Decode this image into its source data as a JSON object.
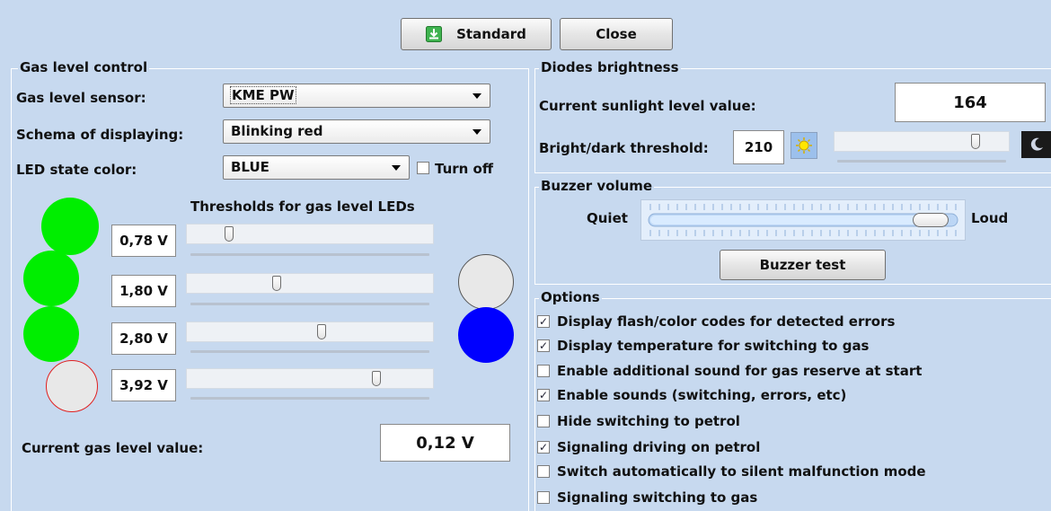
{
  "toolbar": {
    "standard_label": "Standard",
    "close_label": "Close"
  },
  "gas_level_control": {
    "legend": "Gas level control",
    "sensor_label": "Gas level sensor:",
    "sensor_value": "KME PW",
    "schema_label": "Schema of displaying:",
    "schema_value": "Blinking red",
    "led_color_label": "LED state color:",
    "led_color_value": "BLUE",
    "turn_off_label": "Turn off",
    "turn_off_checked": false,
    "thresholds_title": "Thresholds for gas level LEDs",
    "thresholds": [
      {
        "value": "0,78 V",
        "level": 0.16
      },
      {
        "value": "1,80 V",
        "level": 0.36
      },
      {
        "value": "2,80 V",
        "level": 0.55
      },
      {
        "value": "3,92 V",
        "level": 0.78
      }
    ],
    "current_label": "Current gas level value:",
    "current_value": "0,12 V"
  },
  "diodes_brightness": {
    "legend": "Diodes brightness",
    "sunlight_label": "Current sunlight level value:",
    "sunlight_value": "164",
    "threshold_label": "Bright/dark threshold:",
    "threshold_value": "210",
    "threshold_level": 0.82
  },
  "buzzer": {
    "legend": "Buzzer volume",
    "quiet_label": "Quiet",
    "loud_label": "Loud",
    "volume_level": 0.92,
    "test_label": "Buzzer test"
  },
  "options": {
    "legend": "Options",
    "items": [
      {
        "label": "Display flash/color codes for detected errors",
        "checked": true
      },
      {
        "label": "Display temperature for switching to gas",
        "checked": true
      },
      {
        "label": "Enable additional sound for gas reserve at start",
        "checked": false
      },
      {
        "label": "Enable sounds (switching, errors, etc)",
        "checked": true
      },
      {
        "label": "Hide switching to petrol",
        "checked": false
      },
      {
        "label": "Signaling driving on petrol",
        "checked": true
      },
      {
        "label": "Switch automatically to silent malfunction mode",
        "checked": false
      },
      {
        "label": "Signaling switching to gas",
        "checked": false
      }
    ]
  },
  "colors": {
    "background": "#c7d9ef",
    "led_green": "#00ee00",
    "led_off": "#e8e8e8",
    "led_blue": "#0000ff",
    "led_red_border": "#e02020"
  },
  "icons": {
    "standard": "download-arrow-icon",
    "bright": "sun-icon",
    "dark": "moon-icon"
  }
}
